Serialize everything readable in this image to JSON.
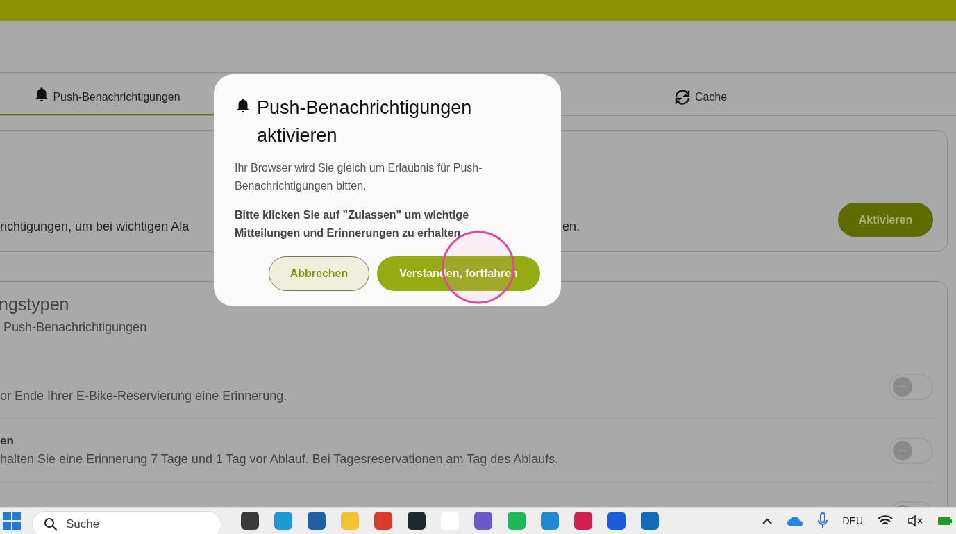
{
  "tabs": [
    {
      "label": "Push-Benachrichtigungen",
      "selected": true,
      "kind": "bell"
    },
    {
      "label": "Cache",
      "selected": false,
      "kind": "refresh"
    }
  ],
  "activation_card": {
    "text_before": "richtigungen, um bei wichtigen Ala",
    "text_after": "en.",
    "button": "Aktivieren"
  },
  "types_card": {
    "title": "ngstypen",
    "subtitle": "Push-Benachrichtigungen",
    "rows": [
      {
        "description": "or Ende Ihrer E-Bike-Reservierung eine Erinnerung.",
        "on": false
      },
      {
        "title": "en",
        "description": "halten Sie eine Erinnerung 7 Tage und 1 Tag vor Ablauf. Bei Tagesreservationen am Tag des Ablaufs.",
        "on": false
      },
      {
        "on": false
      }
    ]
  },
  "dialog": {
    "title": "Push-Benachrichtigungen aktivieren",
    "text": "Ihr Browser wird Sie gleich um Erlaubnis für Push-Benachrichtigungen bitten.",
    "notice": "Bitte klicken Sie auf \"Zulassen\" um wichtige Mitteilungen und Erinnerungen zu erhalten.",
    "cancel": "Abbrechen",
    "confirm": "Verstanden, fortfahren"
  },
  "taskbar": {
    "search_placeholder": "Suche",
    "language": "DEU"
  }
}
